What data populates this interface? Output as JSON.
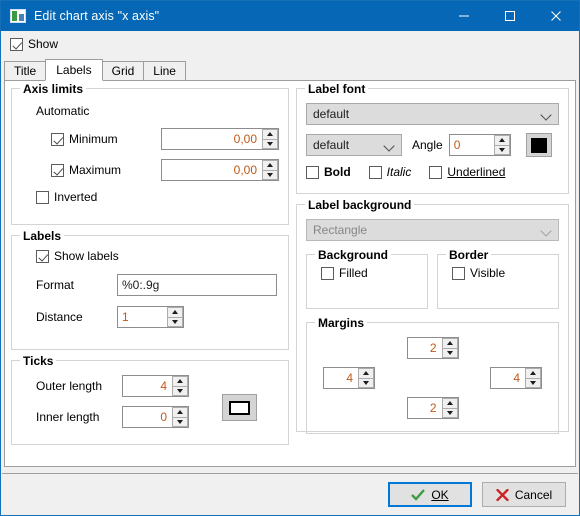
{
  "window": {
    "title": "Edit chart axis \"x axis\"",
    "icon": "chart-icon",
    "minimize_label": "Minimize",
    "maximize_label": "Maximize",
    "close_label": "Close",
    "accent_color": "#0567b5"
  },
  "show_checkbox": {
    "label": "Show",
    "checked": true
  },
  "tabs": [
    {
      "label": "Title",
      "active": false
    },
    {
      "label": "Labels",
      "active": true
    },
    {
      "label": "Grid",
      "active": false
    },
    {
      "label": "Line",
      "active": false
    }
  ],
  "axis_limits": {
    "legend": "Axis limits",
    "automatic_label": "Automatic",
    "minimum": {
      "label": "Minimum",
      "checked": true,
      "value": "0,00"
    },
    "maximum": {
      "label": "Maximum",
      "checked": true,
      "value": "0,00"
    },
    "inverted": {
      "label": "Inverted",
      "checked": false
    }
  },
  "labels": {
    "legend": "Labels",
    "show_labels": {
      "label": "Show labels",
      "checked": true
    },
    "format_label": "Format",
    "format_value": "%0:.9g",
    "distance_label": "Distance",
    "distance_value": "1"
  },
  "ticks": {
    "legend": "Ticks",
    "outer_label": "Outer length",
    "outer_value": "4",
    "inner_label": "Inner length",
    "inner_value": "0",
    "pen_button": "tick-pen-button"
  },
  "label_font": {
    "legend": "Label font",
    "family_value": "default",
    "style_value": "default",
    "angle_label": "Angle",
    "angle_value": "0",
    "color": "#000000",
    "bold": {
      "label": "Bold",
      "checked": false
    },
    "italic": {
      "label": "Italic",
      "checked": false
    },
    "underlined": {
      "label": "Underlined",
      "checked": false
    }
  },
  "label_background": {
    "legend": "Label background",
    "shape_value": "Rectangle",
    "shape_disabled": true,
    "background": {
      "legend": "Background",
      "filled": {
        "label": "Filled",
        "checked": false
      }
    },
    "border": {
      "legend": "Border",
      "visible": {
        "label": "Visible",
        "checked": false
      }
    },
    "margins": {
      "legend": "Margins",
      "top": "2",
      "left": "4",
      "right": "4",
      "bottom": "2"
    }
  },
  "footer": {
    "ok_label": "OK",
    "cancel_label": "Cancel",
    "ok_color": "#3f9a43",
    "cancel_color": "#cc2222"
  }
}
